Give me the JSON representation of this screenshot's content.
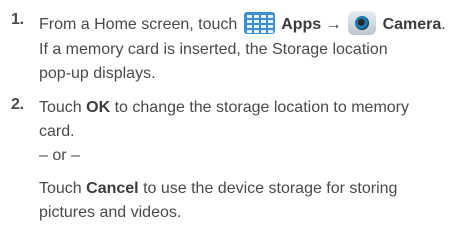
{
  "steps": [
    {
      "number": "1.",
      "line1": {
        "prefix": "From a Home screen, touch",
        "apps_label": "Apps",
        "arrow": "→",
        "camera_label": "Camera",
        "suffix": "."
      },
      "line2": "If a memory card is inserted, the Storage location",
      "line3": "pop-up displays."
    },
    {
      "number": "2.",
      "line1": {
        "prefix": "Touch",
        "ok_label": "OK",
        "suffix": "to change the storage location to memory"
      },
      "line2": "card.",
      "or_text": "– or –",
      "line4": {
        "prefix": "Touch",
        "cancel_label": "Cancel",
        "suffix": "to use the device storage for storing"
      },
      "line5": "pictures and videos."
    }
  ],
  "icons": {
    "apps": "apps-grid-icon",
    "camera": "camera-icon",
    "apps_color": "#3b8fd6"
  }
}
